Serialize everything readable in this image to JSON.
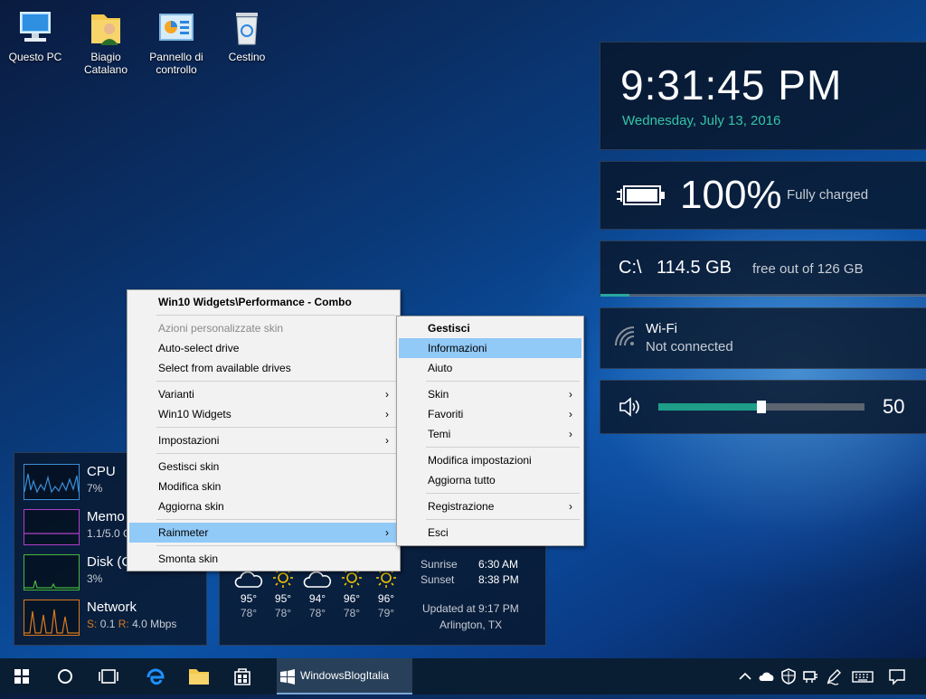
{
  "desktop_icons": [
    {
      "label": "Questo PC",
      "icon": "computer-icon"
    },
    {
      "label": "Biagio Catalano",
      "icon": "user-folder-icon"
    },
    {
      "label": "Pannello di controllo",
      "icon": "control-panel-icon"
    },
    {
      "label": "Cestino",
      "icon": "recycle-bin-icon"
    }
  ],
  "clock": {
    "time": "9:31:45 PM",
    "date": "Wednesday, July 13, 2016",
    "date_color": "#35c4a8"
  },
  "battery": {
    "percent": "100%",
    "status": "Fully charged"
  },
  "disk": {
    "drive": "C:\\",
    "free": "114.5 GB",
    "detail": "free out of 126 GB",
    "used_fraction": 0.09
  },
  "wifi": {
    "name": "Wi-Fi",
    "status": "Not connected"
  },
  "volume": {
    "level": 50,
    "level_label": "50",
    "accent": "#1e9e89"
  },
  "performance": {
    "rows": [
      {
        "title": "CPU",
        "sub": "7%",
        "color": "#3a8fd8"
      },
      {
        "title": "Memo",
        "sub": "1.1/5.0 G",
        "color": "#b040c8"
      },
      {
        "title": "Disk (C",
        "sub": "3%",
        "color": "#46b83e"
      },
      {
        "title": "Network",
        "sub_s_label": "S:",
        "sub_s": "0.1",
        "sub_r_label": "R:",
        "sub_r": "4.0 Mbps",
        "color": "#d87a20"
      }
    ]
  },
  "weather": {
    "days": [
      {
        "icon": "cloud-icon",
        "high": "95°",
        "low": "78°"
      },
      {
        "icon": "sun-icon",
        "high": "95°",
        "low": "78°"
      },
      {
        "icon": "cloud-icon",
        "high": "94°",
        "low": "78°"
      },
      {
        "icon": "sun-icon",
        "high": "96°",
        "low": "78°"
      },
      {
        "icon": "sun-icon",
        "high": "96°",
        "low": "79°"
      }
    ],
    "sunrise_label": "Sunrise",
    "sunrise": "6:30 AM",
    "sunset_label": "Sunset",
    "sunset": "8:38 PM",
    "updated": "Updated at 9:17 PM",
    "location": "Arlington, TX"
  },
  "main_menu": {
    "title": "Win10 Widgets\\Performance - Combo",
    "items": [
      {
        "label": "Azioni personalizzate skin",
        "disabled": true
      },
      {
        "label": "Auto-select drive"
      },
      {
        "label": "Select from available drives"
      },
      {
        "label": "Varianti",
        "submenu": true
      },
      {
        "label": "Win10 Widgets",
        "submenu": true
      },
      {
        "label": "Impostazioni",
        "submenu": true
      },
      {
        "label": "Gestisci skin"
      },
      {
        "label": "Modifica skin"
      },
      {
        "label": "Aggiorna skin"
      },
      {
        "label": "Rainmeter",
        "submenu": true,
        "highlighted": true
      },
      {
        "label": "Smonta skin"
      }
    ]
  },
  "sub_menu": {
    "items": [
      {
        "label": "Gestisci",
        "bold": true
      },
      {
        "label": "Informazioni",
        "highlighted": true
      },
      {
        "label": "Aiuto"
      },
      {
        "label": "Skin",
        "submenu": true
      },
      {
        "label": "Favoriti",
        "submenu": true
      },
      {
        "label": "Temi",
        "submenu": true
      },
      {
        "label": "Modifica impostazioni"
      },
      {
        "label": "Aggiorna tutto"
      },
      {
        "label": "Registrazione",
        "submenu": true
      },
      {
        "label": "Esci"
      }
    ]
  },
  "taskbar": {
    "active_app": "WindowsBlogItalia",
    "highlight_color": "#91c9f7"
  }
}
